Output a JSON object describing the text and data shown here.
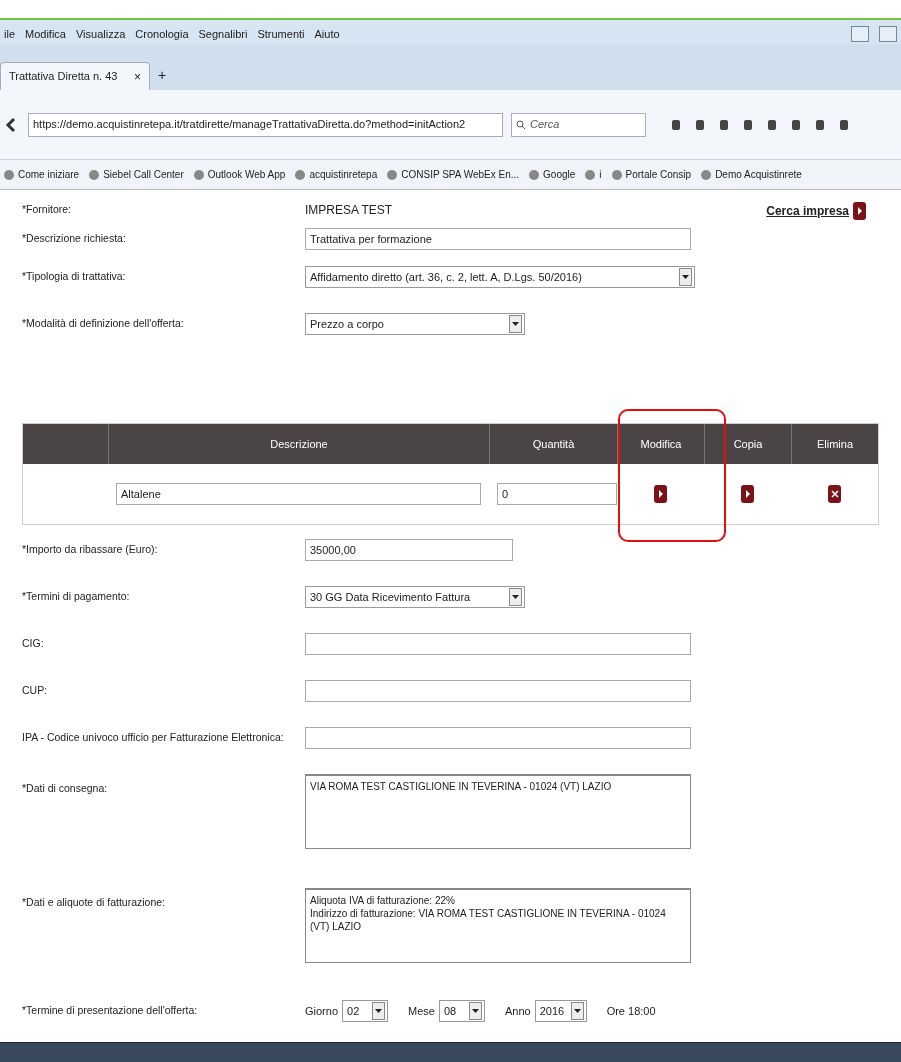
{
  "menu_bar": [
    "ile",
    "Modifica",
    "Visualizza",
    "Cronologia",
    "Segnalibri",
    "Strumenti",
    "Aiuto"
  ],
  "tab": {
    "title": "Trattativa Diretta n. 43",
    "close": "×",
    "new": "+"
  },
  "address_bar": {
    "url": "https://demo.acquistinretepa.it/tratdirette/manageTrattativaDiretta.do?method=initAction2"
  },
  "search": {
    "placeholder": "Cerca"
  },
  "bookmarks": [
    "Come iniziare",
    "Siebel Call Center",
    "Outlook Web App",
    "acquistinretepa",
    "CONSIP SPA WebEx En...",
    "Google",
    "i",
    "Portale Consip",
    "Demo Acquistinrete"
  ],
  "search_company_link": "Cerca impresa",
  "fields_top": [
    {
      "label": "*Fornitore:",
      "kind": "value",
      "value": "IMPRESA TEST"
    },
    {
      "label": "*Descrizione richiesta:",
      "kind": "text",
      "value": "Trattativa per formazione"
    },
    {
      "label": "*Tipologia di trattativa:",
      "kind": "select",
      "value": "Affidamento diretto (art. 36, c. 2, lett. A, D.Lgs. 50/2016)"
    },
    {
      "label": "*Modalità di definizione dell'offerta:",
      "kind": "select",
      "value": "Prezzo a corpo"
    }
  ],
  "table": {
    "columns": [
      {
        "label": "Descrizione",
        "highlighted": false
      },
      {
        "label": "Quantità",
        "highlighted": false
      },
      {
        "label": "Modifica",
        "highlighted": true
      },
      {
        "label": "Copia",
        "highlighted": false
      },
      {
        "label": "Elimina",
        "highlighted": false
      }
    ],
    "rows": [
      {
        "descrizione": "Altalene",
        "quantita": "0"
      }
    ]
  },
  "fields_bottom": [
    {
      "label": "*Importo da ribassare (Euro):",
      "kind": "text",
      "value": "35000,00"
    },
    {
      "label": "*Termini di pagamento:",
      "kind": "select",
      "value": "30 GG Data Ricevimento Fattura"
    },
    {
      "label": "CIG:",
      "kind": "text"
    },
    {
      "label": "CUP:",
      "kind": "text"
    },
    {
      "label": "IPA - Codice univoco ufficio per Fatturazione Elettronica:",
      "kind": "text"
    },
    {
      "label": "*Dati di consegna:",
      "kind": "textarea",
      "lines": [
        "VIA ROMA TEST CASTIGLIONE IN TEVERINA - 01024 (VT) LAZIO"
      ]
    },
    {
      "label": "*Dati e aliquote di fatturazione:",
      "kind": "textarea",
      "lines": [
        "Aliquota IVA di fatturazione: 22%",
        "Indirizzo di fatturazione: VIA ROMA TEST CASTIGLIONE IN TEVERINA - 01024 (VT) LAZIO"
      ]
    }
  ],
  "deadline": {
    "label": "*Termine di presentazione dell'offerta:",
    "parts": [
      {
        "label": "Giorno",
        "value": "02"
      },
      {
        "label": "Mese",
        "value": "08"
      },
      {
        "label": "Anno",
        "value": "2016"
      }
    ],
    "time": "Ore 18:00"
  }
}
